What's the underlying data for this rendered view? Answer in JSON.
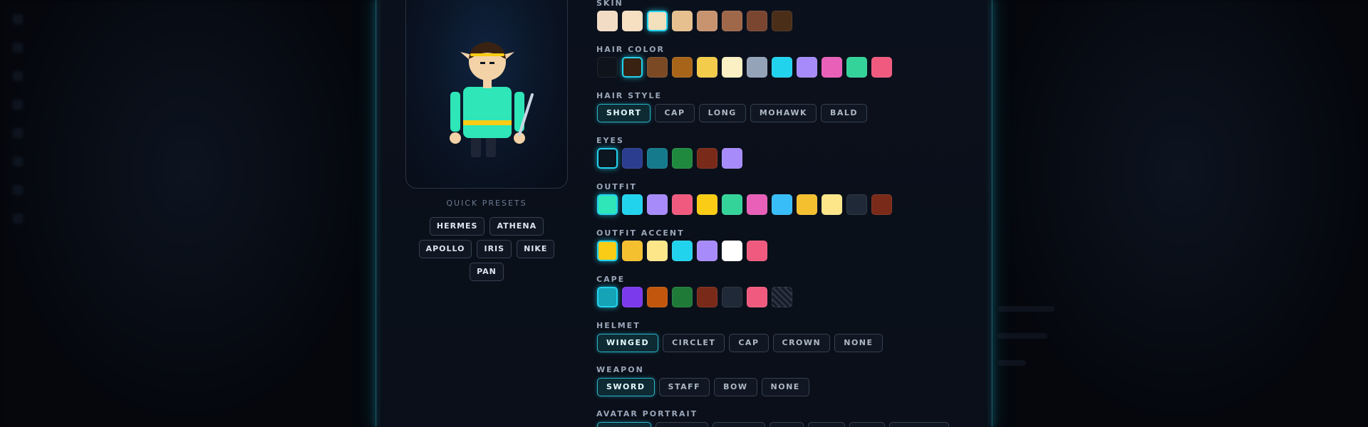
{
  "presets": {
    "label": "QUICK PRESETS",
    "items": [
      "HERMES",
      "ATHENA",
      "APOLLO",
      "IRIS",
      "NIKE",
      "PAN"
    ]
  },
  "groups": {
    "skin": {
      "label": "SKIN",
      "colors": [
        "#f3dcc6",
        "#f7dfc2",
        "#f3e0bd",
        "#e6c08f",
        "#c89470",
        "#a0684a",
        "#7a4630",
        "#4a2e18"
      ],
      "selected": 2
    },
    "hair_color": {
      "label": "HAIR COLOR",
      "colors": [
        "#0f141c",
        "#3a2212",
        "#7b4a24",
        "#a8651a",
        "#f2cc4a",
        "#faf0c4",
        "#94a3b8",
        "#22d3ee",
        "#a78bfa",
        "#e860b8",
        "#34d399",
        "#f05a7e"
      ],
      "selected": 1
    },
    "hair_style": {
      "label": "HAIR STYLE",
      "options": [
        "SHORT",
        "CAP",
        "LONG",
        "MOHAWK",
        "BALD"
      ],
      "selected": 0
    },
    "eyes": {
      "label": "EYES",
      "colors": [
        "#0c1620",
        "#2a3d8f",
        "#147a8c",
        "#1f8a3e",
        "#7a2a18",
        "#a78bfa"
      ],
      "selected": 0
    },
    "outfit": {
      "label": "OUTFIT",
      "colors": [
        "#2ee6b8",
        "#22d3ee",
        "#a78bfa",
        "#f05a7e",
        "#facc15",
        "#34d399",
        "#e860b8",
        "#38bdf8",
        "#f5c030",
        "#fde68a",
        "#1f2937",
        "#7a2a18"
      ],
      "selected": 0
    },
    "outfit_accent": {
      "label": "OUTFIT ACCENT",
      "colors": [
        "#facc15",
        "#f5c030",
        "#fde68a",
        "#22d3ee",
        "#a78bfa",
        "#ffffff",
        "#f05a7e"
      ],
      "selected": 0
    },
    "cape": {
      "label": "CAPE",
      "colors": [
        "#15a3b8",
        "#7c3aed",
        "#c2560c",
        "#1f7a38",
        "#7a2a18",
        "#1f2937",
        "#f05a7e",
        "striped"
      ],
      "selected": 0
    },
    "helmet": {
      "label": "HELMET",
      "options": [
        "WINGED",
        "CIRCLET",
        "CAP",
        "CROWN",
        "NONE"
      ],
      "selected": 0
    },
    "weapon": {
      "label": "WEAPON",
      "options": [
        "SWORD",
        "STAFF",
        "BOW",
        "NONE"
      ],
      "selected": 0
    },
    "avatar_portrait": {
      "label": "AVATAR PORTRAIT"
    }
  }
}
